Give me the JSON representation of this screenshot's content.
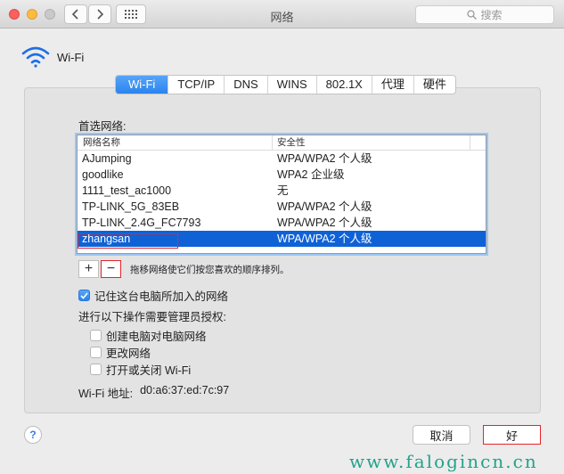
{
  "window": {
    "title": "网络",
    "search_placeholder": "搜索"
  },
  "wifi_header": {
    "label": "Wi-Fi"
  },
  "tabs": [
    {
      "label": "Wi-Fi",
      "active": true
    },
    {
      "label": "TCP/IP"
    },
    {
      "label": "DNS"
    },
    {
      "label": "WINS"
    },
    {
      "label": "802.1X"
    },
    {
      "label": "代理"
    },
    {
      "label": "硬件"
    }
  ],
  "preferred": {
    "title": "首选网络:",
    "columns": [
      "网络名称",
      "安全性"
    ],
    "rows": [
      {
        "name": "AJumping",
        "security": "WPA/WPA2 个人级"
      },
      {
        "name": "goodlike",
        "security": "WPA2 企业级"
      },
      {
        "name": "1111_test_ac1000",
        "security": "无"
      },
      {
        "name": "TP-LINK_5G_83EB",
        "security": "WPA/WPA2 个人级"
      },
      {
        "name": "TP-LINK_2.4G_FC7793",
        "security": "WPA/WPA2 个人级"
      },
      {
        "name": "zhangsan",
        "security": "WPA/WPA2 个人级",
        "selected": true
      }
    ],
    "plus": "+",
    "minus": "−",
    "hint": "拖移网络使它们按您喜欢的顺序排列。"
  },
  "remember": {
    "label": "记住这台电脑所加入的网络",
    "checked": true
  },
  "admin": {
    "label": "进行以下操作需要管理员授权:",
    "options": [
      {
        "label": "创建电脑对电脑网络",
        "checked": false
      },
      {
        "label": "更改网络",
        "checked": false
      },
      {
        "label": "打开或关闭 Wi-Fi",
        "checked": false
      }
    ]
  },
  "mac": {
    "label": "Wi-Fi 地址:",
    "value": "d0:a6:37:ed:7c:97"
  },
  "buttons": {
    "help": "?",
    "cancel": "取消",
    "ok": "好"
  },
  "watermark": "www.falogincn.cn",
  "colors": {
    "accent": "#2a84ee",
    "selected_row": "#0f62d6",
    "highlight": "#e6242a",
    "watermark": "#22a38a"
  }
}
